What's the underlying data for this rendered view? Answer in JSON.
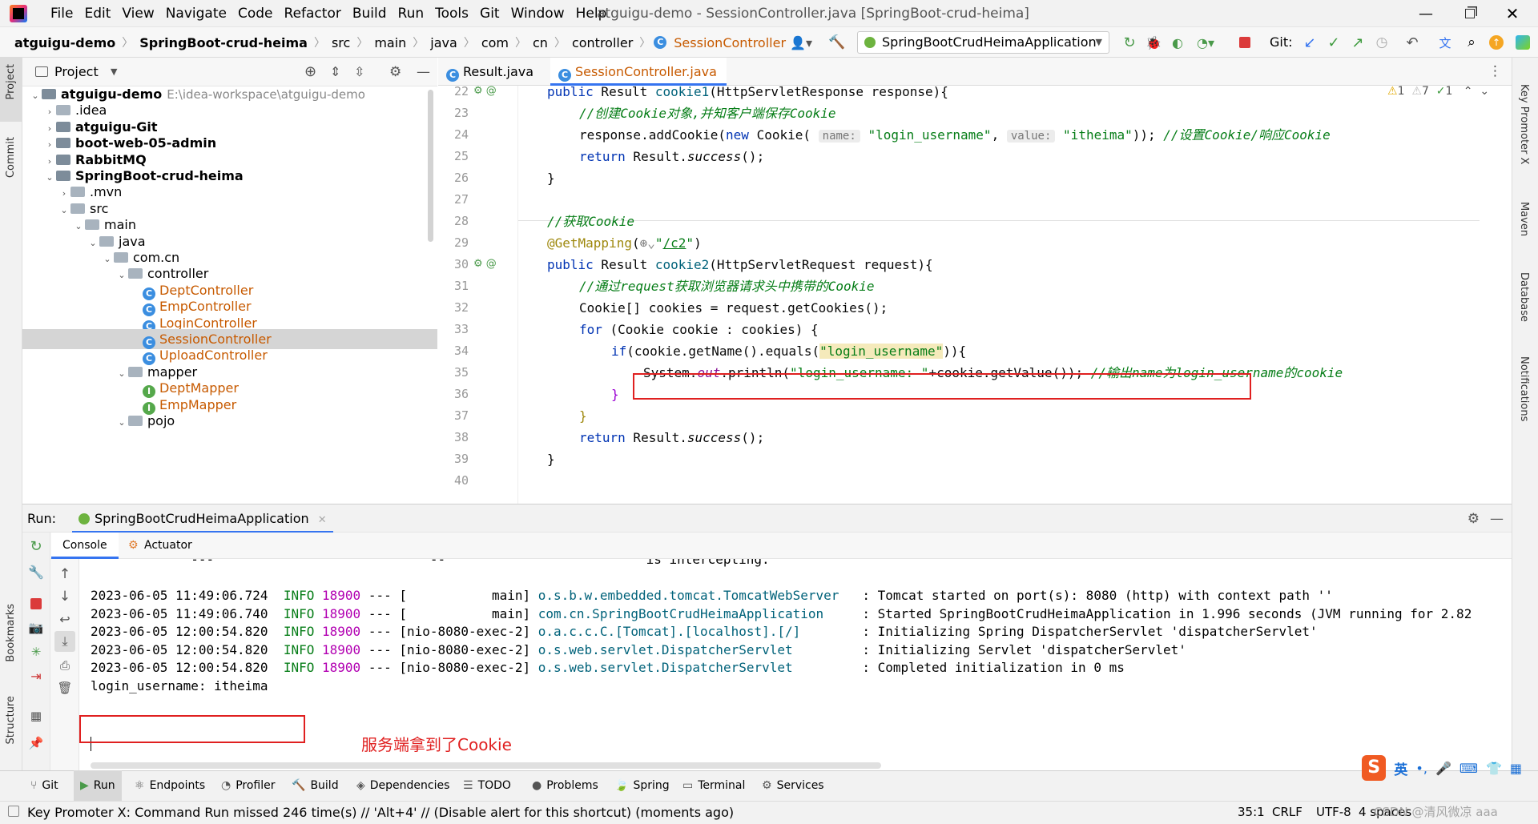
{
  "menu": [
    "File",
    "Edit",
    "View",
    "Navigate",
    "Code",
    "Refactor",
    "Build",
    "Run",
    "Tools",
    "Git",
    "Window",
    "Help"
  ],
  "window_title": "atguigu-demo - SessionController.java [SpringBoot-crud-heima]",
  "breadcrumbs": [
    "atguigu-demo",
    "SpringBoot-crud-heima",
    "src",
    "main",
    "java",
    "com",
    "cn",
    "controller",
    "SessionController"
  ],
  "run_config": "SpringBootCrudHeimaApplication",
  "git_label": "Git:",
  "left_strip": {
    "project": "Project",
    "commit": "Commit",
    "bookmarks": "Bookmarks",
    "structure": "Structure"
  },
  "right_strip": {
    "key_promoter": "Key Promoter X",
    "maven": "Maven",
    "database": "Database",
    "notifications": "Notifications"
  },
  "project_panel": {
    "title": "Project",
    "tree": [
      {
        "label": "atguigu-demo",
        "extra": "E:\\idea-workspace\\atguigu-demo",
        "bold": true,
        "depth": 0,
        "open": true,
        "kind": "module"
      },
      {
        "label": ".idea",
        "depth": 1,
        "open": false,
        "kind": "folder"
      },
      {
        "label": "atguigu-Git",
        "bold": true,
        "depth": 1,
        "open": false,
        "kind": "module"
      },
      {
        "label": "boot-web-05-admin",
        "bold": true,
        "depth": 1,
        "open": false,
        "kind": "module"
      },
      {
        "label": "RabbitMQ",
        "bold": true,
        "depth": 1,
        "open": false,
        "kind": "module"
      },
      {
        "label": "SpringBoot-crud-heima",
        "bold": true,
        "depth": 1,
        "open": true,
        "kind": "module"
      },
      {
        "label": ".mvn",
        "depth": 2,
        "open": false,
        "kind": "folder"
      },
      {
        "label": "src",
        "depth": 2,
        "open": true,
        "kind": "folder"
      },
      {
        "label": "main",
        "depth": 3,
        "open": true,
        "kind": "folder"
      },
      {
        "label": "java",
        "depth": 4,
        "open": true,
        "kind": "folder"
      },
      {
        "label": "com.cn",
        "depth": 5,
        "open": true,
        "kind": "folder"
      },
      {
        "label": "controller",
        "depth": 6,
        "open": true,
        "kind": "folder"
      },
      {
        "label": "DeptController",
        "depth": 7,
        "kind": "class"
      },
      {
        "label": "EmpController",
        "depth": 7,
        "kind": "class"
      },
      {
        "label": "LoginController",
        "depth": 7,
        "kind": "class"
      },
      {
        "label": "SessionController",
        "depth": 7,
        "kind": "class",
        "selected": true
      },
      {
        "label": "UploadController",
        "depth": 7,
        "kind": "class"
      },
      {
        "label": "mapper",
        "depth": 6,
        "open": true,
        "kind": "folder"
      },
      {
        "label": "DeptMapper",
        "depth": 7,
        "kind": "interface"
      },
      {
        "label": "EmpMapper",
        "depth": 7,
        "kind": "interface"
      },
      {
        "label": "pojo",
        "depth": 6,
        "open": true,
        "kind": "folder"
      }
    ]
  },
  "editor": {
    "tabs": [
      "Result.java",
      "SessionController.java"
    ],
    "inspections": {
      "warn1": "1",
      "warn2": "7",
      "info": "1"
    },
    "line_numbers": [
      "22",
      "23",
      "24",
      "25",
      "26",
      "27",
      "28",
      "29",
      "30",
      "31",
      "32",
      "33",
      "34",
      "35",
      "36",
      "37",
      "38",
      "39",
      "40"
    ],
    "hints": {
      "name": "name:",
      "value": "value:"
    }
  },
  "run": {
    "label": "Run:",
    "tab": "SpringBootCrudHeimaApplication",
    "subtabs": [
      "Console",
      "Actuator"
    ],
    "console_lines": [
      {
        "plain": "            `---'                          `--'                         is intercepting."
      },
      {
        "plain": ""
      },
      {
        "date": "2023-06-05 11:49:06.724",
        "level": "INFO",
        "pid": "18900",
        "thread": "--- [           main]",
        "logger": "o.s.b.w.embedded.tomcat.TomcatWebServer ",
        "msg": "  : Tomcat started on port(s): 8080 (http) with context path ''"
      },
      {
        "date": "2023-06-05 11:49:06.740",
        "level": "INFO",
        "pid": "18900",
        "thread": "--- [           main]",
        "logger": "com.cn.SpringBootCrudHeimaApplication   ",
        "msg": "  : Started SpringBootCrudHeimaApplication in 1.996 seconds (JVM running for 2.82"
      },
      {
        "date": "2023-06-05 12:00:54.820",
        "level": "INFO",
        "pid": "18900",
        "thread": "--- [nio-8080-exec-2]",
        "logger": "o.a.c.c.C.[Tomcat].[localhost].[/]      ",
        "msg": "  : Initializing Spring DispatcherServlet 'dispatcherServlet'"
      },
      {
        "date": "2023-06-05 12:00:54.820",
        "level": "INFO",
        "pid": "18900",
        "thread": "--- [nio-8080-exec-2]",
        "logger": "o.s.web.servlet.DispatcherServlet       ",
        "msg": "  : Initializing Servlet 'dispatcherServlet'"
      },
      {
        "date": "2023-06-05 12:00:54.820",
        "level": "INFO",
        "pid": "18900",
        "thread": "--- [nio-8080-exec-2]",
        "logger": "o.s.web.servlet.DispatcherServlet       ",
        "msg": "  : Completed initialization in 0 ms"
      },
      {
        "plain": "login_username: itheima"
      }
    ],
    "annotation": "服务端拿到了Cookie"
  },
  "bottom_tools": [
    "Git",
    "Run",
    "Endpoints",
    "Profiler",
    "Build",
    "Dependencies",
    "TODO",
    "Problems",
    "Spring",
    "Terminal",
    "Services"
  ],
  "status": {
    "message": "Key Promoter X: Command Run missed 246 time(s) // 'Alt+4' // (Disable alert for this shortcut) (moments ago)",
    "position": "35:1",
    "line_sep": "CRLF",
    "encoding": "UTF-8",
    "indent": "4 spaces",
    "watermark": "CSDN @清风微凉 aaa"
  },
  "ime": {
    "lang": "英"
  },
  "colors": {
    "accent": "#3574f0",
    "highlight_box": "#e02020",
    "annotation": "#e02020",
    "string": "#067d17",
    "keyword": "#0033b3"
  }
}
